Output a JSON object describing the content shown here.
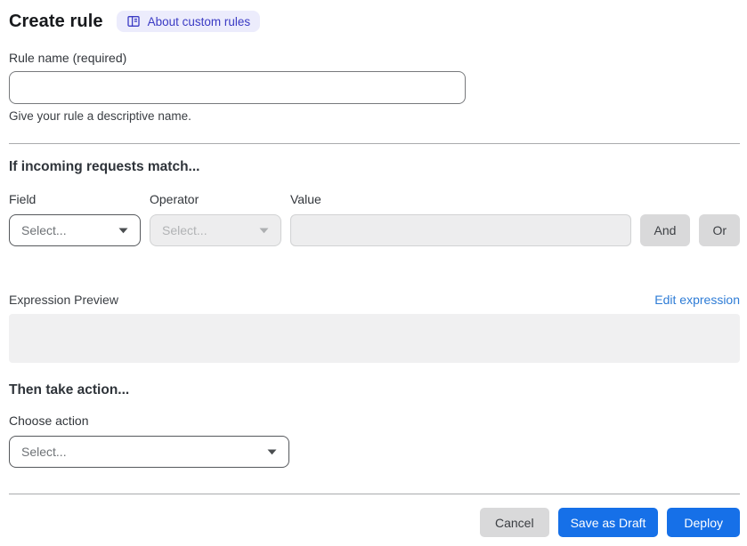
{
  "header": {
    "title": "Create rule",
    "about_badge": {
      "label": "About custom rules",
      "icon": "book-icon"
    }
  },
  "rule_name": {
    "label": "Rule name (required)",
    "value": "",
    "helper": "Give your rule a descriptive name."
  },
  "match": {
    "heading": "If incoming requests match...",
    "field": {
      "label": "Field",
      "placeholder": "Select..."
    },
    "operator": {
      "label": "Operator",
      "placeholder": "Select...",
      "disabled": true
    },
    "value": {
      "label": "Value",
      "value": "",
      "disabled": true
    },
    "and_label": "And",
    "or_label": "Or",
    "expression_preview": {
      "label": "Expression Preview",
      "edit_link": "Edit expression",
      "content": ""
    }
  },
  "action": {
    "heading": "Then take action...",
    "choose": {
      "label": "Choose action",
      "placeholder": "Select..."
    }
  },
  "footer": {
    "cancel_label": "Cancel",
    "save_draft_label": "Save as Draft",
    "deploy_label": "Deploy"
  },
  "colors": {
    "primary_button": "#1670e8",
    "badge_bg": "#ececfc",
    "badge_text": "#3b3bc4",
    "link": "#2e7cd6",
    "disabled_bg": "#ededee",
    "divider": "#a9abad"
  }
}
